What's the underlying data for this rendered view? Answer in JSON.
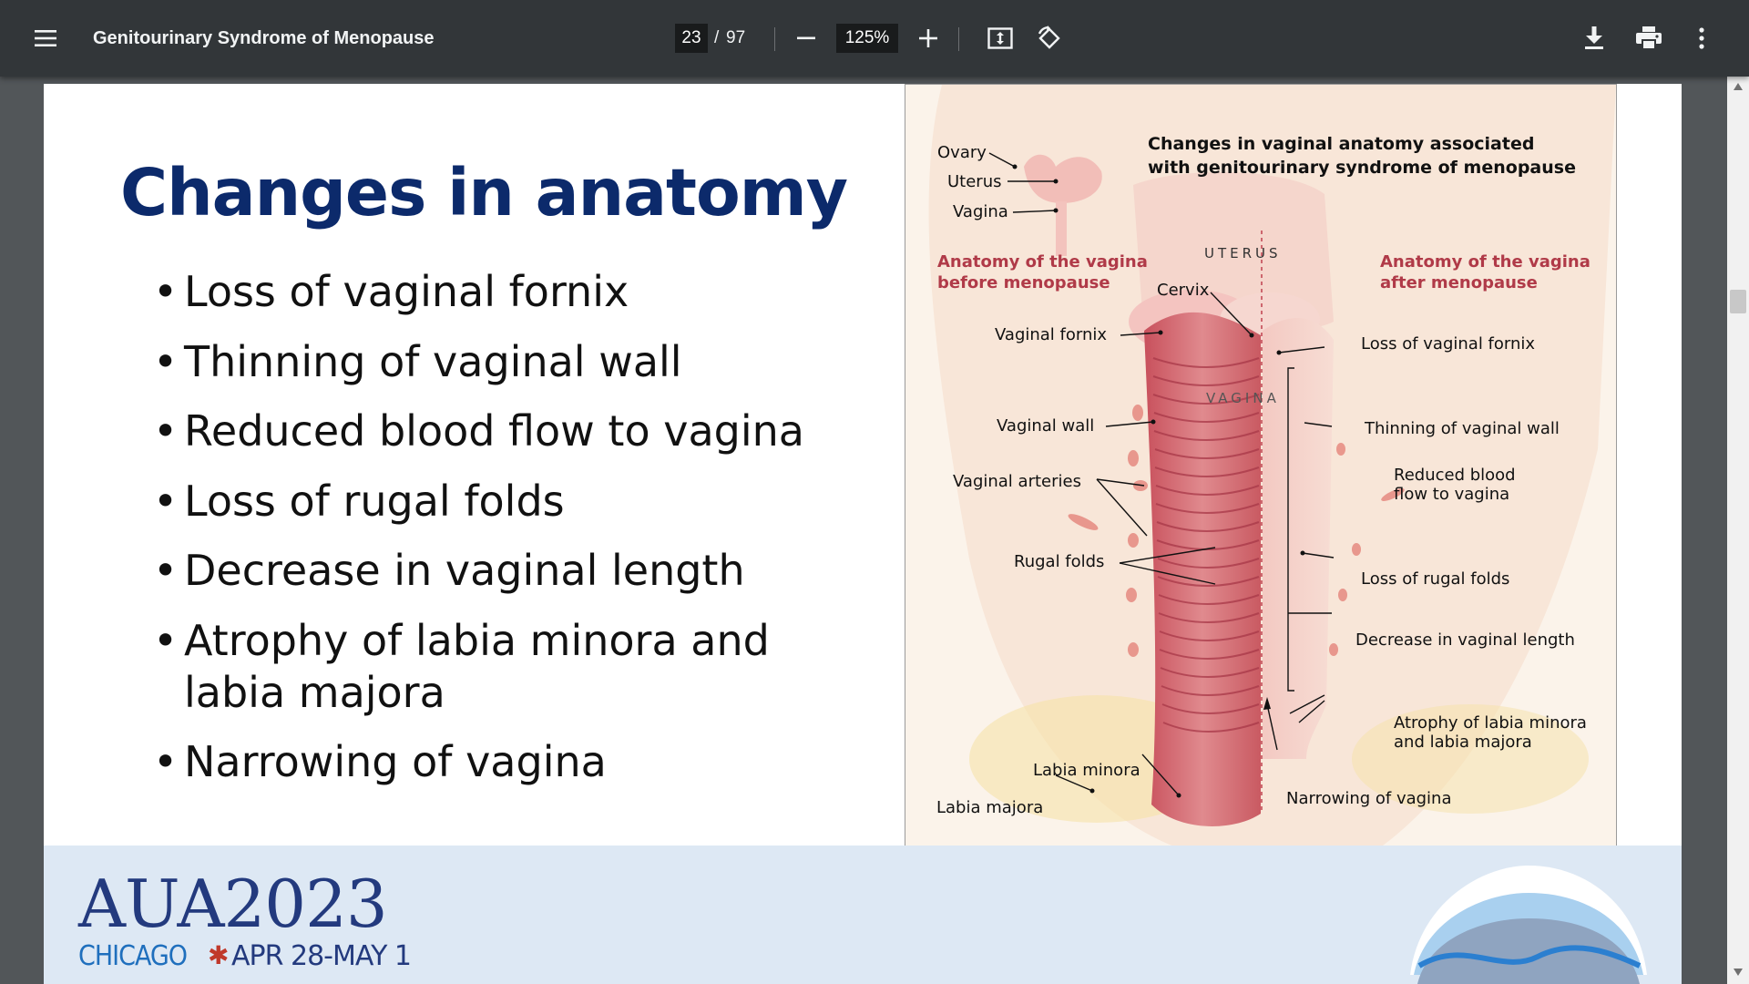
{
  "toolbar": {
    "menu_icon": "hamburger-menu-icon",
    "title": "Genitourinary Syndrome of Menopause",
    "page_current": "23",
    "page_separator": "/",
    "page_total": "97",
    "zoom": "125%",
    "icons": [
      "zoom-out-icon",
      "zoom-in-icon",
      "fit-page-icon",
      "rotate-icon",
      "download-icon",
      "print-icon",
      "more-vert-icon"
    ]
  },
  "slide": {
    "title": "Changes in anatomy",
    "bullets": [
      "Loss of vaginal fornix",
      "Thinning of vaginal wall",
      "Reduced blood flow to vagina",
      "Loss of rugal folds",
      "Decrease in vaginal length",
      "Atrophy of labia minora and labia majora",
      "Narrowing of vagina"
    ]
  },
  "figure": {
    "heading_line1": "Changes in vaginal anatomy associated",
    "heading_line2": "with genitourinary syndrome of menopause",
    "inset_ovary": "Ovary",
    "inset_uterus": "Uterus",
    "inset_vagina": "Vagina",
    "uterus_label": "UTERUS",
    "vagina_label": "VAGINA",
    "before_line1": "Anatomy of the vagina",
    "before_line2": "before menopause",
    "after_line1": "Anatomy of the vagina",
    "after_line2": "after menopause",
    "left_labels": {
      "cervix": "Cervix",
      "fornix": "Vaginal fornix",
      "wall": "Vaginal wall",
      "arteries": "Vaginal arteries",
      "rugal": "Rugal folds",
      "labia_minora": "Labia minora",
      "labia_majora": "Labia majora"
    },
    "right_labels": {
      "loss_fornix": "Loss of vaginal fornix",
      "thinning": "Thinning of vaginal wall",
      "reduced_line1": "Reduced blood",
      "reduced_line2": "flow to vagina",
      "loss_rugal": "Loss of rugal folds",
      "decrease_length": "Decrease in vaginal length",
      "atrophy_line1": "Atrophy of labia minora",
      "atrophy_line2": "and labia majora",
      "narrowing": "Narrowing of vagina"
    }
  },
  "footer": {
    "brand": "AUA2023",
    "city": "CHICAGO",
    "dates": "APR 28-MAY 1"
  },
  "colors": {
    "toolbar_bg": "#323639",
    "viewer_bg": "#525659",
    "title_blue": "#0c2a6b",
    "figure_red_label": "#b03a48",
    "footer_bg": "#dde8f4"
  }
}
